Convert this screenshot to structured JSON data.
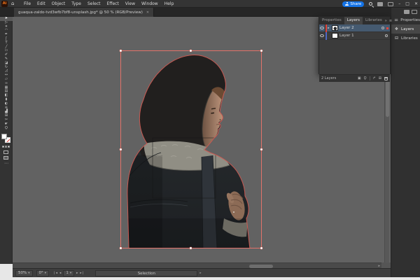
{
  "window": {
    "minimize": "–",
    "maximize": "□",
    "close": "✕"
  },
  "app": {
    "logo_text": "Ai",
    "home_icon": "⌂",
    "menus": [
      "File",
      "Edit",
      "Object",
      "Type",
      "Select",
      "Effect",
      "View",
      "Window",
      "Help"
    ],
    "share": {
      "label": "Share",
      "color": "#1473e6"
    }
  },
  "document_tab": {
    "title": "guaqua-zaldo-tvd3wfb7bf8-unsplash.jpg* @ 50 % (RGB/Preview)",
    "close_icon": "✕"
  },
  "toolbar": {
    "tools": [
      {
        "name": "Selection",
        "glyph": "➤",
        "active": true
      },
      {
        "name": "Direct Selection",
        "glyph": "▷"
      },
      {
        "name": "Magic Wand",
        "glyph": "✶"
      },
      {
        "name": "Lasso",
        "glyph": "◠"
      },
      {
        "name": "Pen",
        "glyph": "✒"
      },
      {
        "name": "Curvature",
        "glyph": "ʃ"
      },
      {
        "name": "Type",
        "glyph": "T"
      },
      {
        "name": "Line Segment",
        "glyph": "╱"
      },
      {
        "name": "Rectangle",
        "glyph": "▭"
      },
      {
        "name": "Paintbrush",
        "glyph": "✐"
      },
      {
        "name": "Shaper",
        "glyph": "✎"
      },
      {
        "name": "Eraser",
        "glyph": "◪"
      },
      {
        "name": "Rotate",
        "glyph": "↻"
      },
      {
        "name": "Scale",
        "glyph": "◿"
      },
      {
        "name": "Width",
        "glyph": "↔"
      },
      {
        "name": "Free Transform",
        "glyph": "▱"
      },
      {
        "name": "Shape Builder",
        "glyph": "∞"
      },
      {
        "name": "Perspective Grid",
        "glyph": "▦"
      },
      {
        "name": "Mesh",
        "glyph": "▤"
      },
      {
        "name": "Gradient",
        "glyph": "◧"
      },
      {
        "name": "Eyedropper",
        "glyph": "⧫"
      },
      {
        "name": "Blend",
        "glyph": "◐"
      },
      {
        "name": "Symbol Sprayer",
        "glyph": "❊"
      },
      {
        "name": "Column Graph",
        "glyph": "▟"
      },
      {
        "name": "Artboard",
        "glyph": "⊞"
      },
      {
        "name": "Slice",
        "glyph": "✂"
      },
      {
        "name": "Hand",
        "glyph": "☛"
      },
      {
        "name": "Zoom",
        "glyph": "Ϙ"
      }
    ],
    "more_icon": "⋯"
  },
  "canvas": {
    "background": "#626262",
    "selection_color": "#e2736b",
    "path_outline_color": "#d05a52",
    "artwork": "hooded person cutout, facing right, dark jacket with shearling collar"
  },
  "layers_panel": {
    "tabs": [
      {
        "label": "Properties"
      },
      {
        "label": "Layers",
        "active": true
      },
      {
        "label": "Libraries"
      }
    ],
    "collapse_icon": "»",
    "menu_icon": "≡",
    "rows": [
      {
        "name": "Layer 2",
        "color": "#e0443a",
        "selected": true,
        "disclosure": "▸"
      },
      {
        "name": "Layer 1",
        "color": "#4f69c6",
        "selected": false
      }
    ],
    "count_label": "2 Layers",
    "icons": {
      "clip_mask": "▣",
      "locate": "Ϙ",
      "new_sublayer": "↱",
      "new_layer": "⊞"
    }
  },
  "dock": {
    "items": [
      {
        "label": "Properties",
        "glyph": "⚌"
      },
      {
        "label": "Layers",
        "glyph": "❖",
        "active": true
      },
      {
        "label": "Libraries",
        "glyph": "⊟"
      }
    ]
  },
  "status_bar": {
    "zoom_value": "50%",
    "rotation_value": "0°",
    "nav_first": "❘◂",
    "nav_prev": "◂",
    "artboard_number": "1",
    "nav_next": "▸",
    "nav_last": "▸❘",
    "dropdown_icon": "▾",
    "status_label": "Selection"
  }
}
